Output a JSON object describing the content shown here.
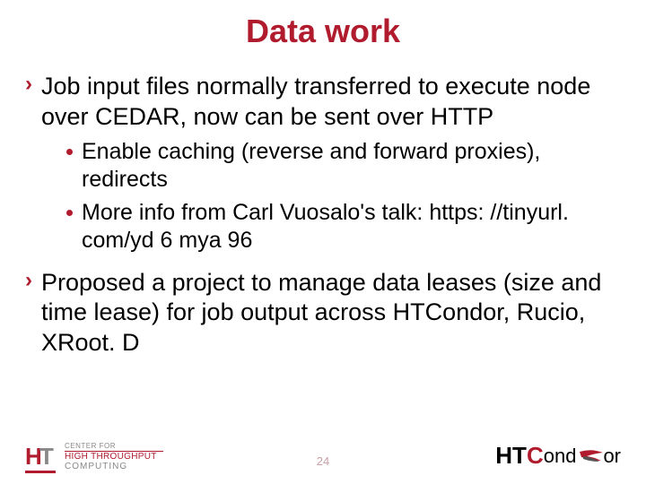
{
  "title": "Data work",
  "bullets": [
    {
      "text": "Job input files normally transferred to execute node over CEDAR, now can be sent over HTTP",
      "sub": [
        "Enable caching (reverse and forward proxies), redirects",
        "More info from Carl Vuosalo's talk: https: //tinyurl. com/yd 6 mya 96"
      ]
    },
    {
      "text": "Proposed a project to manage data leases (size and time lease) for job output across HTCondor, Rucio, XRoot. D",
      "sub": []
    }
  ],
  "footer": {
    "left_top": "CENTER FOR",
    "left_mid": "HIGH THROUGHPUT",
    "left_bot": "COMPUTING",
    "page": "24",
    "right_ht": "HT",
    "right_c": "C",
    "right_rest": "ond"
  }
}
